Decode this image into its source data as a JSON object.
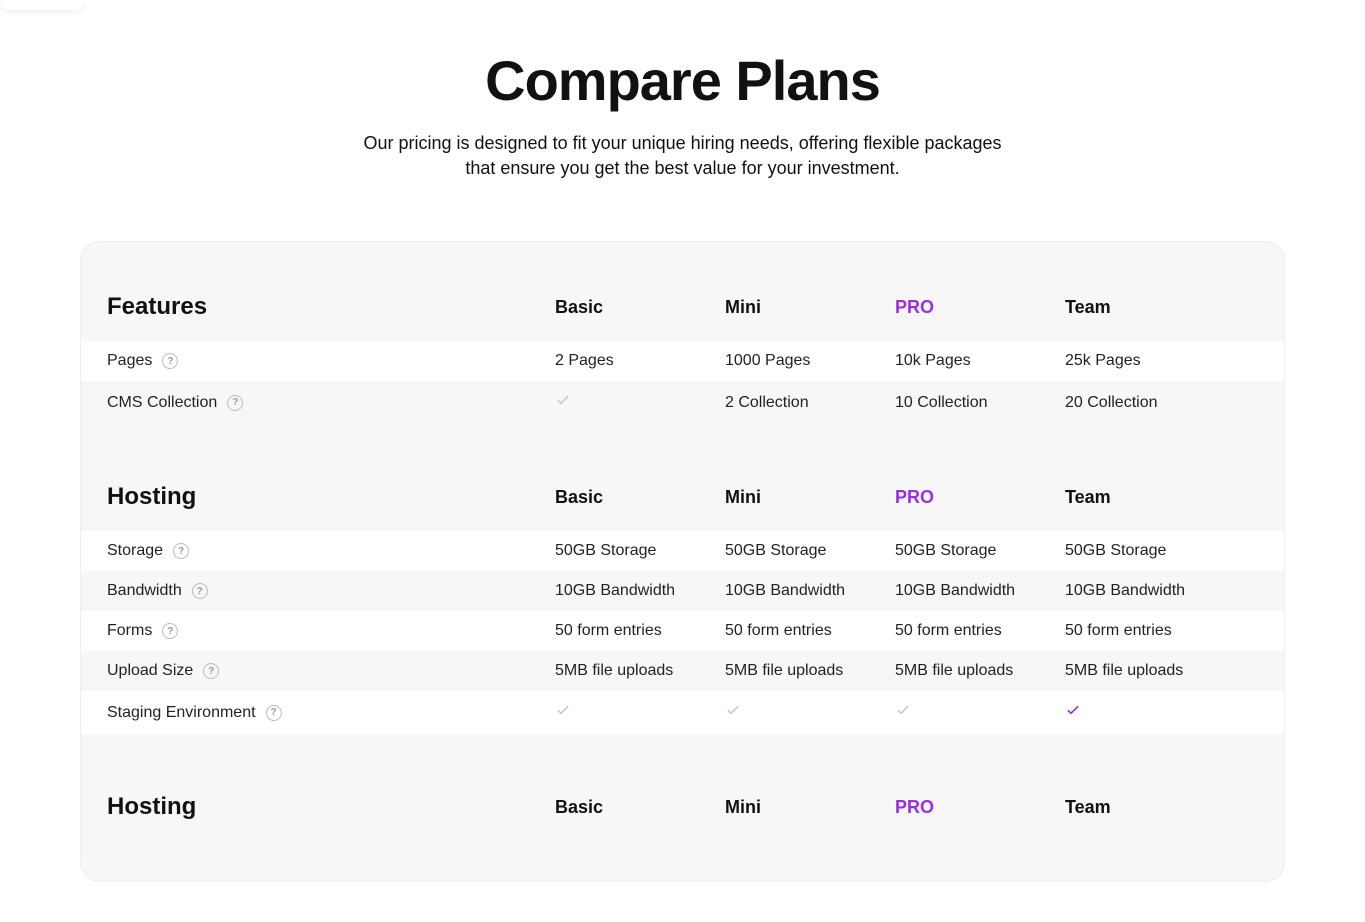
{
  "header": {
    "title": "Compare Plans",
    "subtitle": "Our pricing is designed to fit your unique hiring needs, offering flexible packages that ensure you get the best value for your investment."
  },
  "plans": [
    "Basic",
    "Mini",
    "PRO",
    "Team"
  ],
  "sections": [
    {
      "name": "Features",
      "rows": [
        {
          "label": "Pages",
          "help": true,
          "cells": [
            "2 Pages",
            "1000 Pages",
            "10k Pages",
            "25k Pages"
          ]
        },
        {
          "label": "CMS Collection",
          "help": true,
          "cells": [
            "__check_muted",
            "2 Collection",
            "10 Collection",
            "20 Collection"
          ]
        }
      ]
    },
    {
      "name": "Hosting",
      "rows": [
        {
          "label": "Storage",
          "help": true,
          "cells": [
            "50GB Storage",
            "50GB Storage",
            "50GB Storage",
            "50GB Storage"
          ]
        },
        {
          "label": "Bandwidth",
          "help": true,
          "cells": [
            "10GB Bandwidth",
            "10GB Bandwidth",
            "10GB Bandwidth",
            "10GB Bandwidth"
          ]
        },
        {
          "label": "Forms",
          "help": true,
          "cells": [
            "50 form entries",
            "50 form entries",
            "50 form entries",
            "50 form entries"
          ]
        },
        {
          "label": "Upload Size",
          "help": true,
          "cells": [
            "5MB file uploads",
            "5MB file uploads",
            "5MB file uploads",
            "5MB file uploads"
          ]
        },
        {
          "label": "Staging Environment",
          "help": true,
          "cells": [
            "__check_muted",
            "__check_muted",
            "__check_muted",
            "__check_accent"
          ]
        }
      ]
    },
    {
      "name": "Hosting",
      "rows": []
    }
  ]
}
